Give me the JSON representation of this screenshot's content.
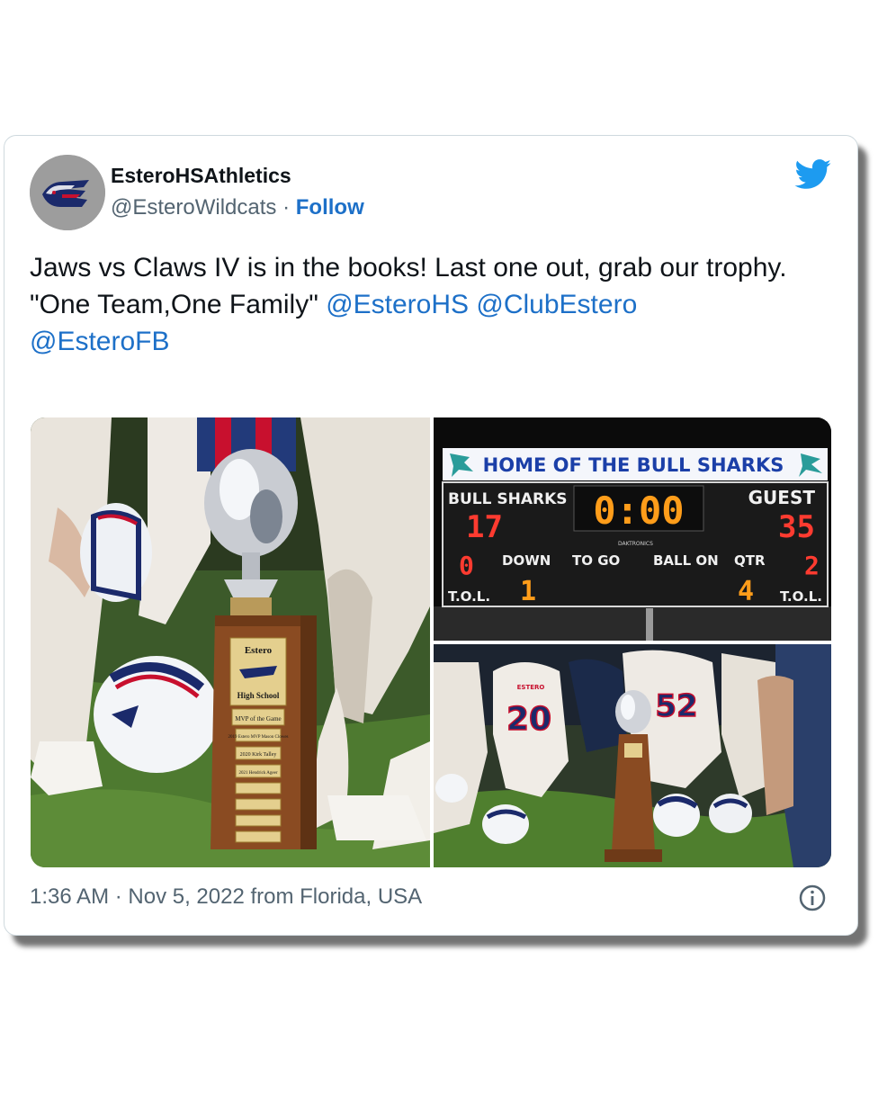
{
  "account": {
    "display_name": "EsteroHSAthletics",
    "handle": "@EsteroWildcats",
    "separator": "·",
    "follow_label": "Follow"
  },
  "tweet": {
    "line1": "Jaws vs Claws IV is in the books! Last one out, grab our trophy.",
    "quote": "\"One Team,One Family\"",
    "mentions": [
      "@EsteroHS",
      "@ClubEstero",
      "@EsteroFB"
    ],
    "timestamp": "1:36 AM · Nov 5, 2022 from Florida, USA"
  },
  "scoreboard": {
    "banner": "HOME OF THE BULL SHARKS",
    "home_label": "BULL SHARKS",
    "guest_label": "GUEST",
    "clock": "0:00",
    "home_score": "17",
    "guest_score": "35",
    "home_tol": "0",
    "guest_tol": "2",
    "down_label": "DOWN",
    "togo_label": "TO GO",
    "ballon_label": "BALL ON",
    "qtr_label": "QTR",
    "tol_label": "T.O.L.",
    "down": "1",
    "qtr": "4",
    "brand": "DAKTRONICS"
  },
  "trophy": {
    "school_top": "Estero",
    "school_bottom": "High School",
    "plate1": "MVP of the Game",
    "plate2": "2019 Estero MVP Mason Clowes",
    "plate3": "2020 Kirk Talley",
    "plate4": "2021 Hendrick Ageer"
  },
  "jerseys": {
    "number_left": "20",
    "number_right": "52",
    "team": "ESTERO"
  },
  "colors": {
    "link": "#1d70c8",
    "twitter_blue": "#1d9bf0",
    "text_secondary": "#536471",
    "scoreboard_red": "#ff3b30",
    "scoreboard_amber": "#ff9d1a"
  }
}
